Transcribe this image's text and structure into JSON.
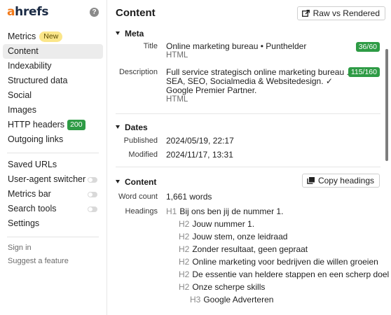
{
  "sidebar": {
    "logo": {
      "a": "a",
      "rest": "hrefs"
    },
    "help_icon": "?",
    "items": [
      {
        "label": "Metrics",
        "badge": "New"
      },
      {
        "label": "Content"
      },
      {
        "label": "Indexability"
      },
      {
        "label": "Structured data"
      },
      {
        "label": "Social"
      },
      {
        "label": "Images"
      },
      {
        "label": "HTTP headers",
        "badge": "200"
      },
      {
        "label": "Outgoing links"
      }
    ],
    "tools": [
      {
        "label": "Saved URLs"
      },
      {
        "label": "User-agent switcher",
        "toggle": "off"
      },
      {
        "label": "Metrics bar",
        "toggle": "off"
      },
      {
        "label": "Search tools",
        "toggle": "off"
      },
      {
        "label": "Settings"
      }
    ],
    "footer": [
      {
        "label": "Sign in"
      },
      {
        "label": "Suggest a feature"
      }
    ]
  },
  "main": {
    "title": "Content",
    "raw_button": "Raw vs Rendered",
    "meta": {
      "heading": "Meta",
      "title_label": "Title",
      "title_value": "Online marketing bureau • Punthelder",
      "title_sub": "HTML",
      "title_count": "36/60",
      "description_label": "Description",
      "description_lines": [
        "Full service strategisch online marketing bureau .",
        "SEA, SEO, Socialmedia & Websitedesign. ✓",
        "Google Premier Partner."
      ],
      "description_sub": "HTML",
      "description_count": "115/160"
    },
    "dates": {
      "heading": "Dates",
      "published_label": "Published",
      "published_value": "2024/05/19, 22:17",
      "modified_label": "Modified",
      "modified_value": "2024/11/17, 13:31"
    },
    "content": {
      "heading": "Content",
      "copy_button": "Copy headings",
      "word_count_label": "Word count",
      "word_count_value": "1,661 words",
      "headings_label": "Headings",
      "headings": [
        {
          "level": "H1",
          "text": "Bij ons ben jij de nummer 1."
        },
        {
          "level": "H2",
          "text": "Jouw nummer 1."
        },
        {
          "level": "H2",
          "text": "Jouw stem, onze leidraad"
        },
        {
          "level": "H2",
          "text": "Zonder resultaat, geen gepraat"
        },
        {
          "level": "H2",
          "text": "Online marketing voor bedrijven die willen groeien"
        },
        {
          "level": "H2",
          "text": "De essentie van heldere stappen en een scherp doel"
        },
        {
          "level": "H2",
          "text": "Onze scherpe skills"
        },
        {
          "level": "H3",
          "text": "Google Adverteren"
        }
      ]
    }
  },
  "colors": {
    "accent_orange": "#f27a1a",
    "badge_green": "#2e9b45",
    "badge_new_yellow": "#fbe68a"
  }
}
